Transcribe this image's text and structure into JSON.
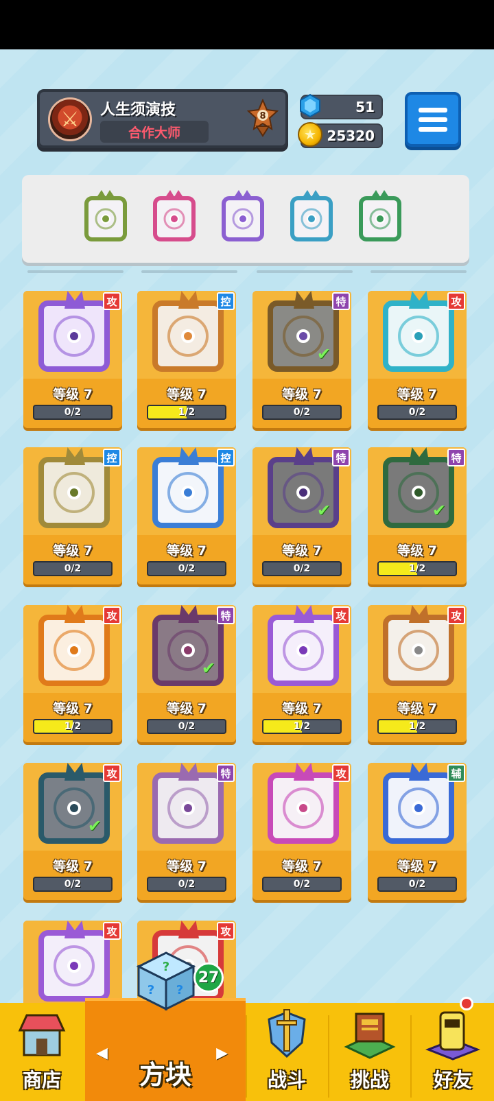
{
  "profile": {
    "name": "人生须演技",
    "title": "合作大师",
    "rank": "8",
    "avatar_icon": "sword-icon"
  },
  "currency": {
    "gems": "51",
    "gold": "25320"
  },
  "equipped": [
    {
      "icon": "infinity-dice-icon",
      "color": "#7a9b3c"
    },
    {
      "icon": "syringe-dice-icon",
      "color": "#d64c8c"
    },
    {
      "icon": "eye-dice-icon",
      "color": "#8b5fd1"
    },
    {
      "icon": "vortex-dice-icon",
      "color": "#3a9fc4"
    },
    {
      "icon": "pentagram-dice-icon",
      "color": "#3a9a5a"
    }
  ],
  "cards": [
    {
      "tag": "攻",
      "tag_color": "#e53935",
      "level": "等级 7",
      "progress": "0/2",
      "fill": 0,
      "color": "#8e5bd6",
      "bg": "#efe5fb",
      "pip": "#5b3b9a",
      "checked": false,
      "icon": "wind-dice-icon"
    },
    {
      "tag": "控",
      "tag_color": "#1e88e5",
      "level": "等级 7",
      "progress": "1/2",
      "fill": 0.5,
      "color": "#c97a2a",
      "bg": "#f4ece2",
      "pip": "#e08a3a",
      "checked": false,
      "icon": "sand-dice-icon"
    },
    {
      "tag": "特",
      "tag_color": "#8e44ad",
      "level": "等级 7",
      "progress": "0/2",
      "fill": 0,
      "color": "#7a5a28",
      "bg": "#8a8a86",
      "pip": "#6a4aa8",
      "checked": true,
      "icon": "infinity-dice-icon"
    },
    {
      "tag": "攻",
      "tag_color": "#e53935",
      "level": "等级 7",
      "progress": "0/2",
      "fill": 0,
      "color": "#2fb2c8",
      "bg": "#eaf6f8",
      "pip": "#2aa0b8",
      "checked": false,
      "icon": "trident-dice-icon"
    },
    {
      "tag": "控",
      "tag_color": "#1e88e5",
      "level": "等级 7",
      "progress": "0/2",
      "fill": 0,
      "color": "#a08a3a",
      "bg": "#efeadc",
      "pip": "#6a7a2a",
      "checked": false,
      "icon": "shield-dice-icon"
    },
    {
      "tag": "控",
      "tag_color": "#1e88e5",
      "level": "等级 7",
      "progress": "0/2",
      "fill": 0,
      "color": "#3b7ed6",
      "bg": "#f3f6fb",
      "pip": "#3b7ed6",
      "checked": false,
      "icon": "snowflake-dice-icon"
    },
    {
      "tag": "特",
      "tag_color": "#8e44ad",
      "level": "等级 7",
      "progress": "0/2",
      "fill": 0,
      "color": "#5a3f8a",
      "bg": "#7a7a7a",
      "pip": "#4a2f7a",
      "checked": true,
      "icon": "eye-dice-icon"
    },
    {
      "tag": "特",
      "tag_color": "#8e44ad",
      "level": "等级 7",
      "progress": "1/2",
      "fill": 0.5,
      "color": "#2f6a3f",
      "bg": "#7a7a7a",
      "pip": "#2f5a2a",
      "checked": true,
      "icon": "pentagram-dice-icon"
    },
    {
      "tag": "攻",
      "tag_color": "#e53935",
      "level": "等级 7",
      "progress": "1/2",
      "fill": 0.5,
      "color": "#e07a1a",
      "bg": "#fbefe0",
      "pip": "#e07a1a",
      "checked": false,
      "icon": "fire-dice-icon"
    },
    {
      "tag": "特",
      "tag_color": "#8e44ad",
      "level": "等级 7",
      "progress": "0/2",
      "fill": 0,
      "color": "#6a3a6a",
      "bg": "#8a7a86",
      "pip": "#8a3a6a",
      "checked": true,
      "icon": "syringe-dice-icon"
    },
    {
      "tag": "攻",
      "tag_color": "#e53935",
      "level": "等级 7",
      "progress": "1/2",
      "fill": 0.5,
      "color": "#9a5ad6",
      "bg": "#f5effb",
      "pip": "#7a3ab8",
      "checked": false,
      "icon": "orbit-dice-icon"
    },
    {
      "tag": "攻",
      "tag_color": "#e53935",
      "level": "等级 7",
      "progress": "1/2",
      "fill": 0.5,
      "color": "#c0702a",
      "bg": "#f4f0ea",
      "pip": "#888888",
      "checked": false,
      "icon": "gun-dice-icon"
    },
    {
      "tag": "攻",
      "tag_color": "#e53935",
      "level": "等级 7",
      "progress": "0/2",
      "fill": 0,
      "color": "#2a5a6a",
      "bg": "#7a8088",
      "pip": "#2a4a5a",
      "checked": true,
      "icon": "vortex-dice-icon"
    },
    {
      "tag": "特",
      "tag_color": "#8e44ad",
      "level": "等级 7",
      "progress": "0/2",
      "fill": 0,
      "color": "#9a6ab0",
      "bg": "#eeeaf0",
      "pip": "#7a4a9a",
      "checked": false,
      "icon": "mist-dice-icon"
    },
    {
      "tag": "攻",
      "tag_color": "#e53935",
      "level": "等级 7",
      "progress": "0/2",
      "fill": 0,
      "color": "#c84ab8",
      "bg": "#f6f0f6",
      "pip": "#c84a8a",
      "checked": false,
      "icon": "combo-dice-icon"
    },
    {
      "tag": "辅",
      "tag_color": "#2e8b57",
      "level": "等级 7",
      "progress": "0/2",
      "fill": 0,
      "color": "#3a6ad6",
      "bg": "#f0f3fb",
      "pip": "#3a6ad6",
      "checked": false,
      "icon": "moon-dice-icon"
    },
    {
      "tag": "攻",
      "tag_color": "#e53935",
      "level": "",
      "progress": "",
      "fill": 0,
      "color": "#9a5ad6",
      "bg": "#f3eefa",
      "pip": "#7a3ab8",
      "checked": false,
      "icon": "star-dice-icon"
    },
    {
      "tag": "攻",
      "tag_color": "#e53935",
      "level": "",
      "progress": "",
      "fill": 0,
      "color": "#d63a3a",
      "bg": "#f2f2f2",
      "pip": "#888888",
      "checked": false,
      "icon": "saw-dice-icon"
    }
  ],
  "nav": {
    "shop": "商店",
    "dice": "方块",
    "battle": "战斗",
    "challenge": "挑战",
    "friends": "好友",
    "dice_count": "27"
  }
}
